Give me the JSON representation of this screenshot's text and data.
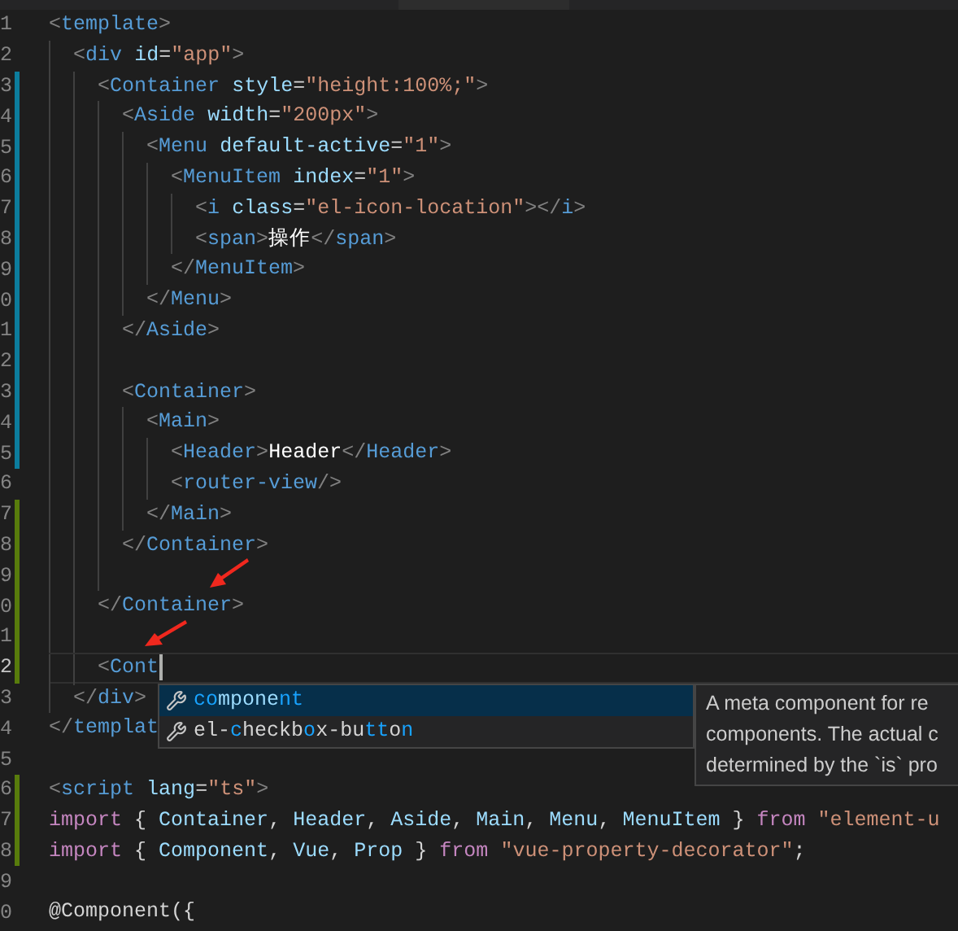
{
  "editor": {
    "lines": [
      {
        "number": "1",
        "kind": "unchanged",
        "current": false,
        "tokens": [
          {
            "kind": "bracket",
            "text": "<"
          },
          {
            "kind": "tag",
            "text": "template"
          },
          {
            "kind": "bracket",
            "text": ">"
          }
        ]
      },
      {
        "number": "2",
        "kind": "unchanged",
        "current": false,
        "tokens": [
          {
            "kind": "bracket",
            "text": "  <"
          },
          {
            "kind": "tag",
            "text": "div"
          },
          {
            "kind": "attr",
            "text": " id"
          },
          {
            "kind": "plain",
            "text": "="
          },
          {
            "kind": "string",
            "text": "\"app\""
          },
          {
            "kind": "bracket",
            "text": ">"
          }
        ]
      },
      {
        "number": "3",
        "kind": "modified",
        "current": false,
        "tokens": [
          {
            "kind": "bracket",
            "text": "    <"
          },
          {
            "kind": "tag",
            "text": "Container"
          },
          {
            "kind": "attr",
            "text": " style"
          },
          {
            "kind": "plain",
            "text": "="
          },
          {
            "kind": "string",
            "text": "\"height:100%;\""
          },
          {
            "kind": "bracket",
            "text": ">"
          }
        ]
      },
      {
        "number": "4",
        "kind": "modified",
        "current": false,
        "tokens": [
          {
            "kind": "bracket",
            "text": "      <"
          },
          {
            "kind": "tag",
            "text": "Aside"
          },
          {
            "kind": "attr",
            "text": " width"
          },
          {
            "kind": "plain",
            "text": "="
          },
          {
            "kind": "string",
            "text": "\"200px\""
          },
          {
            "kind": "bracket",
            "text": ">"
          }
        ]
      },
      {
        "number": "5",
        "kind": "modified",
        "current": false,
        "tokens": [
          {
            "kind": "bracket",
            "text": "        <"
          },
          {
            "kind": "tag",
            "text": "Menu"
          },
          {
            "kind": "attr",
            "text": " default-active"
          },
          {
            "kind": "plain",
            "text": "="
          },
          {
            "kind": "string",
            "text": "\"1\""
          },
          {
            "kind": "bracket",
            "text": ">"
          }
        ]
      },
      {
        "number": "6",
        "kind": "modified",
        "current": false,
        "tokens": [
          {
            "kind": "bracket",
            "text": "          <"
          },
          {
            "kind": "tag",
            "text": "MenuItem"
          },
          {
            "kind": "attr",
            "text": " index"
          },
          {
            "kind": "plain",
            "text": "="
          },
          {
            "kind": "string",
            "text": "\"1\""
          },
          {
            "kind": "bracket",
            "text": ">"
          }
        ]
      },
      {
        "number": "7",
        "kind": "modified",
        "current": false,
        "tokens": [
          {
            "kind": "bracket",
            "text": "            <"
          },
          {
            "kind": "tag",
            "text": "i"
          },
          {
            "kind": "attr",
            "text": " class"
          },
          {
            "kind": "plain",
            "text": "="
          },
          {
            "kind": "string",
            "text": "\"el-icon-location\""
          },
          {
            "kind": "bracket",
            "text": "></"
          },
          {
            "kind": "tag",
            "text": "i"
          },
          {
            "kind": "bracket",
            "text": ">"
          }
        ]
      },
      {
        "number": "8",
        "kind": "modified",
        "current": false,
        "tokens": [
          {
            "kind": "bracket",
            "text": "            <"
          },
          {
            "kind": "tag",
            "text": "span"
          },
          {
            "kind": "bracket",
            "text": ">"
          },
          {
            "kind": "content",
            "text": "操作"
          },
          {
            "kind": "bracket",
            "text": "</"
          },
          {
            "kind": "tag",
            "text": "span"
          },
          {
            "kind": "bracket",
            "text": ">"
          }
        ]
      },
      {
        "number": "9",
        "kind": "modified",
        "current": false,
        "tokens": [
          {
            "kind": "bracket",
            "text": "          </"
          },
          {
            "kind": "tag",
            "text": "MenuItem"
          },
          {
            "kind": "bracket",
            "text": ">"
          }
        ]
      },
      {
        "number": "0",
        "kind": "modified",
        "current": false,
        "tokens": [
          {
            "kind": "bracket",
            "text": "        </"
          },
          {
            "kind": "tag",
            "text": "Menu"
          },
          {
            "kind": "bracket",
            "text": ">"
          }
        ]
      },
      {
        "number": "1",
        "kind": "modified",
        "current": false,
        "tokens": [
          {
            "kind": "bracket",
            "text": "      </"
          },
          {
            "kind": "tag",
            "text": "Aside"
          },
          {
            "kind": "bracket",
            "text": ">"
          }
        ]
      },
      {
        "number": "2",
        "kind": "modified",
        "current": false
      },
      {
        "number": "3",
        "kind": "modified",
        "current": false,
        "tokens": [
          {
            "kind": "bracket",
            "text": "      <"
          },
          {
            "kind": "tag",
            "text": "Container"
          },
          {
            "kind": "bracket",
            "text": ">"
          }
        ]
      },
      {
        "number": "4",
        "kind": "modified",
        "current": false,
        "tokens": [
          {
            "kind": "bracket",
            "text": "        <"
          },
          {
            "kind": "tag",
            "text": "Main"
          },
          {
            "kind": "bracket",
            "text": ">"
          }
        ]
      },
      {
        "number": "5",
        "kind": "modified",
        "current": false,
        "tokens": [
          {
            "kind": "bracket",
            "text": "          <"
          },
          {
            "kind": "tag",
            "text": "Header"
          },
          {
            "kind": "bracket",
            "text": ">"
          },
          {
            "kind": "content",
            "text": "Header"
          },
          {
            "kind": "bracket",
            "text": "</"
          },
          {
            "kind": "tag",
            "text": "Header"
          },
          {
            "kind": "bracket",
            "text": ">"
          }
        ]
      },
      {
        "number": "6",
        "kind": "unchanged",
        "current": false,
        "tokens": [
          {
            "kind": "bracket",
            "text": "          <"
          },
          {
            "kind": "tag",
            "text": "router-view"
          },
          {
            "kind": "bracket",
            "text": "/>"
          }
        ]
      },
      {
        "number": "7",
        "kind": "added",
        "current": false,
        "tokens": [
          {
            "kind": "bracket",
            "text": "        </"
          },
          {
            "kind": "tag",
            "text": "Main"
          },
          {
            "kind": "bracket",
            "text": ">"
          }
        ]
      },
      {
        "number": "8",
        "kind": "added",
        "current": false,
        "tokens": [
          {
            "kind": "bracket",
            "text": "      </"
          },
          {
            "kind": "tag",
            "text": "Container"
          },
          {
            "kind": "bracket",
            "text": ">"
          }
        ]
      },
      {
        "number": "9",
        "kind": "added",
        "current": false
      },
      {
        "number": "0",
        "kind": "added",
        "current": false,
        "tokens": [
          {
            "kind": "bracket",
            "text": "    </"
          },
          {
            "kind": "tag",
            "text": "Container"
          },
          {
            "kind": "bracket",
            "text": ">"
          }
        ]
      },
      {
        "number": "1",
        "kind": "added",
        "current": false
      },
      {
        "number": "2",
        "kind": "added",
        "current": true,
        "tokens": [
          {
            "kind": "bracket",
            "text": "    <"
          },
          {
            "kind": "tag",
            "text": "Cont"
          }
        ]
      },
      {
        "number": "3",
        "kind": "unchanged",
        "current": false,
        "tokens": [
          {
            "kind": "bracket",
            "text": "  </"
          },
          {
            "kind": "tag",
            "text": "div"
          },
          {
            "kind": "bracket",
            "text": ">"
          }
        ]
      },
      {
        "number": "4",
        "kind": "unchanged",
        "current": false,
        "tokens": [
          {
            "kind": "bracket",
            "text": "</"
          },
          {
            "kind": "tag",
            "text": "templat"
          }
        ]
      },
      {
        "number": "5",
        "kind": "unchanged",
        "current": false
      },
      {
        "number": "6",
        "kind": "added",
        "current": false,
        "tokens": [
          {
            "kind": "bracket",
            "text": "<"
          },
          {
            "kind": "tag",
            "text": "script"
          },
          {
            "kind": "attr",
            "text": " lang"
          },
          {
            "kind": "plain",
            "text": "="
          },
          {
            "kind": "string",
            "text": "\"ts\""
          },
          {
            "kind": "bracket",
            "text": ">"
          }
        ]
      },
      {
        "number": "7",
        "kind": "added",
        "current": false,
        "tokens": [
          {
            "kind": "keyword",
            "text": "import"
          },
          {
            "kind": "plain",
            "text": " { "
          },
          {
            "kind": "attr",
            "text": "Container"
          },
          {
            "kind": "plain",
            "text": ", "
          },
          {
            "kind": "attr",
            "text": "Header"
          },
          {
            "kind": "plain",
            "text": ", "
          },
          {
            "kind": "attr",
            "text": "Aside"
          },
          {
            "kind": "plain",
            "text": ", "
          },
          {
            "kind": "attr",
            "text": "Main"
          },
          {
            "kind": "plain",
            "text": ", "
          },
          {
            "kind": "attr",
            "text": "Menu"
          },
          {
            "kind": "plain",
            "text": ", "
          },
          {
            "kind": "attr",
            "text": "MenuItem"
          },
          {
            "kind": "plain",
            "text": " } "
          },
          {
            "kind": "keyword",
            "text": "from"
          },
          {
            "kind": "string",
            "text": " \"element-u"
          }
        ]
      },
      {
        "number": "8",
        "kind": "added",
        "current": false,
        "tokens": [
          {
            "kind": "keyword",
            "text": "import"
          },
          {
            "kind": "plain",
            "text": " { "
          },
          {
            "kind": "attr",
            "text": "Component"
          },
          {
            "kind": "plain",
            "text": ", "
          },
          {
            "kind": "attr",
            "text": "Vue"
          },
          {
            "kind": "plain",
            "text": ", "
          },
          {
            "kind": "attr",
            "text": "Prop"
          },
          {
            "kind": "plain",
            "text": " } "
          },
          {
            "kind": "keyword",
            "text": "from"
          },
          {
            "kind": "string",
            "text": " \"vue-property-decorator\""
          },
          {
            "kind": "plain",
            "text": ";"
          }
        ]
      },
      {
        "number": "9",
        "kind": "unchanged",
        "current": false
      },
      {
        "number": "0",
        "kind": "unchanged",
        "current": false,
        "tokens": [
          {
            "kind": "plain",
            "text": "@Component({"
          }
        ]
      }
    ]
  },
  "suggestions": {
    "items": [
      {
        "selected": true,
        "parts": [
          {
            "text": "co",
            "match": true
          },
          {
            "text": "mpone",
            "match": false
          },
          {
            "text": "nt",
            "match": true
          }
        ]
      },
      {
        "selected": false,
        "parts": [
          {
            "text": "el-",
            "match": false
          },
          {
            "text": "c",
            "match": true
          },
          {
            "text": "heckb",
            "match": false
          },
          {
            "text": "o",
            "match": true
          },
          {
            "text": "x-bu",
            "match": false
          },
          {
            "text": "tt",
            "match": true
          },
          {
            "text": "o",
            "match": false
          },
          {
            "text": "n",
            "match": true
          }
        ]
      }
    ],
    "details": [
      "A meta component for re",
      "components. The actual c",
      "determined by the `is` pro"
    ]
  }
}
